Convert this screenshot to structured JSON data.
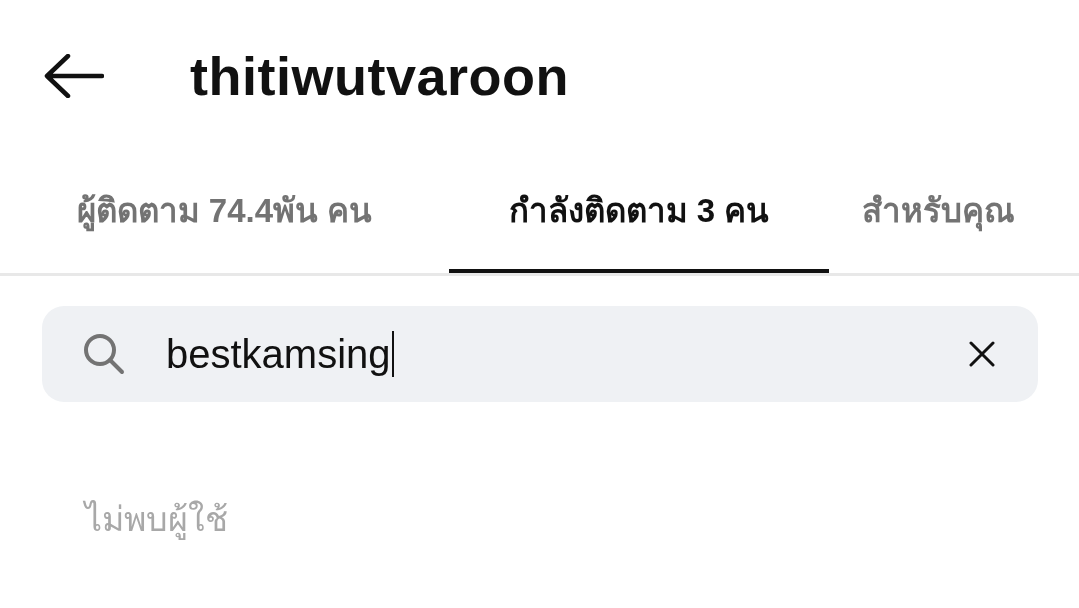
{
  "header": {
    "title": "thitiwutvaroon"
  },
  "tabs": [
    {
      "label": "ผู้ติดตาม 74.4พัน คน",
      "selected": false
    },
    {
      "label": "กำลังติดตาม 3 คน",
      "selected": true
    },
    {
      "label": "สำหรับคุณ",
      "selected": false
    }
  ],
  "search": {
    "value": "bestkamsing",
    "focused": true
  },
  "empty_message": "ไม่พบผู้ใช้"
}
